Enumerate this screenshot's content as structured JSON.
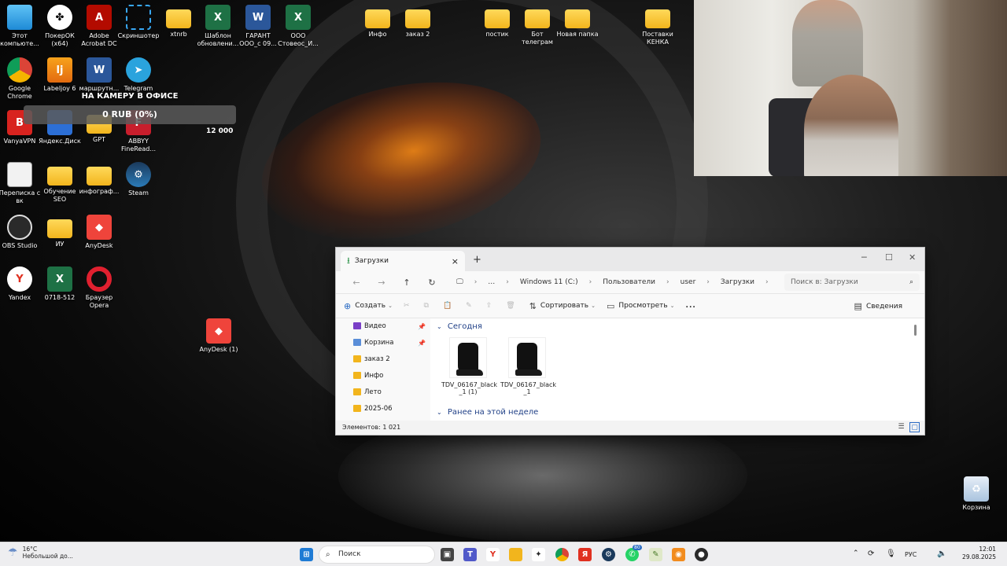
{
  "desktop": {
    "icons": [
      {
        "label": "Этот компьюте...",
        "icon": "computer-icon"
      },
      {
        "label": "ПокерОК (x64)",
        "icon": "pokerok-icon"
      },
      {
        "label": "Adobe Acrobat DC",
        "icon": "acrobat-icon"
      },
      {
        "label": "Скриншотер",
        "icon": "screenshoter-icon"
      },
      {
        "label": "xtnrb",
        "icon": "folder-icon"
      },
      {
        "label": "Шаблон обновлени...",
        "icon": "excel-icon"
      },
      {
        "label": "ГАРАНТ ООО_с 09...",
        "icon": "word-icon"
      },
      {
        "label": "ООО Стовеос_И...",
        "icon": "excel-icon"
      },
      {
        "label": "Инфо",
        "icon": "folder-icon"
      },
      {
        "label": "заказ 2",
        "icon": "folder-icon"
      },
      {
        "label": "постик",
        "icon": "folder-icon"
      },
      {
        "label": "Бот телеграм",
        "icon": "folder-icon"
      },
      {
        "label": "Новая папка",
        "icon": "folder-icon"
      },
      {
        "label": "Поставки КЕНКА",
        "icon": "folder-icon"
      },
      {
        "label": "Google Chrome",
        "icon": "chrome-icon"
      },
      {
        "label": "Labeljoy 6",
        "icon": "labeljoy-icon"
      },
      {
        "label": "маршрутн...",
        "icon": "word-icon"
      },
      {
        "label": "Telegram",
        "icon": "telegram-icon"
      },
      {
        "label": "VanyaVPN",
        "icon": "vpn-icon"
      },
      {
        "label": "Яндекс.Диск",
        "icon": "yandex-disk-icon"
      },
      {
        "label": "GPT",
        "icon": "folder-icon"
      },
      {
        "label": "ABBYY FineRead...",
        "icon": "abbyy-icon"
      },
      {
        "label": "Переписка с вк",
        "icon": "document-icon"
      },
      {
        "label": "Обучение SEO",
        "icon": "folder-icon"
      },
      {
        "label": "инфограф...",
        "icon": "folder-icon"
      },
      {
        "label": "Steam",
        "icon": "steam-icon"
      },
      {
        "label": "OBS Studio",
        "icon": "obs-icon"
      },
      {
        "label": "ИУ",
        "icon": "folder-icon"
      },
      {
        "label": "AnyDesk",
        "icon": "anydesk-icon"
      },
      {
        "label": "Yandex",
        "icon": "yandex-browser-icon"
      },
      {
        "label": "0718-512",
        "icon": "excel-icon"
      },
      {
        "label": "Браузер Opera",
        "icon": "opera-icon"
      },
      {
        "label": "AnyDesk (1)",
        "icon": "anydesk-icon"
      },
      {
        "label": "Корзина",
        "icon": "recycle-bin-icon"
      }
    ]
  },
  "overlay": {
    "title": "НА КАМЕРУ В ОФИСЕ",
    "progress_text": "0 RUB (0%)",
    "goal": "12 000",
    "progress_fraction": 0
  },
  "explorer": {
    "tab_title": "Загрузки",
    "breadcrumbs": [
      "Windows 11 (C:)",
      "Пользователи",
      "user",
      "Загрузки"
    ],
    "search_placeholder": "Поиск в: Загрузки",
    "commands": {
      "create": "Создать",
      "sort": "Сортировать",
      "view": "Просмотреть",
      "more": "...",
      "details": "Сведения"
    },
    "nav_items": [
      {
        "label": "Видео",
        "pinned": true,
        "color": "#7a3fc7"
      },
      {
        "label": "Корзина",
        "pinned": true,
        "color": "#5a8ed8"
      },
      {
        "label": "заказ 2",
        "pinned": false,
        "color": "#f2b51d"
      },
      {
        "label": "Инфо",
        "pinned": false,
        "color": "#f2b51d"
      },
      {
        "label": "Лето",
        "pinned": false,
        "color": "#f2b51d"
      },
      {
        "label": "2025-06",
        "pinned": false,
        "color": "#f2b51d"
      }
    ],
    "groups": {
      "today": "Сегодня",
      "earlier_this_week": "Ранее на этой неделе"
    },
    "files": [
      {
        "name_line1": "TDV_06167_black",
        "name_line2": "_1 (1)"
      },
      {
        "name_line1": "TDV_06167_black",
        "name_line2": "_1"
      }
    ],
    "status": "Элементов: 1 021"
  },
  "taskbar": {
    "weather_temp": "16°C",
    "weather_desc": "Небольшой до...",
    "search_label": "Поиск",
    "language": "РУС",
    "time": "12:01",
    "date": "29.08.2025",
    "whatsapp_badge": "80"
  }
}
